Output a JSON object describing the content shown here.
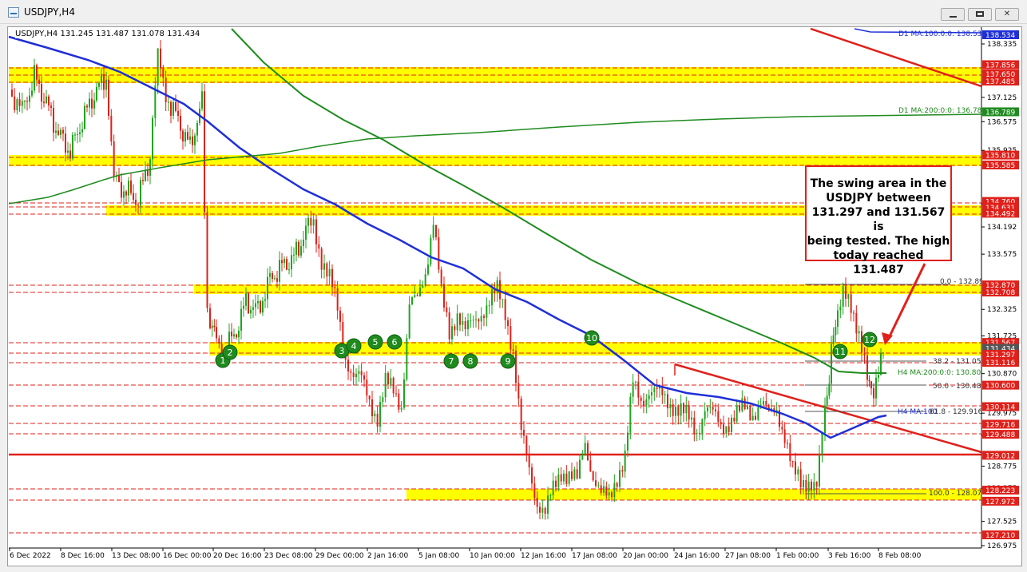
{
  "window": {
    "title": "USDJPY,H4"
  },
  "chart": {
    "header": "USDJPY,H4  131.245 131.487 131.078 131.434",
    "price_labels": [
      "138.335",
      "137.125",
      "136.575",
      "135.925",
      "134.715",
      "134.192",
      "133.575",
      "132.325",
      "131.725",
      "130.870",
      "129.975",
      "129.475",
      "128.775",
      "128.275",
      "127.525",
      "126.975"
    ],
    "x_labels": [
      "6 Dec 2022",
      "8 Dec 16:00",
      "13 Dec 08:00",
      "16 Dec 00:00",
      "20 Dec 16:00",
      "23 Dec 08:00",
      "29 Dec 00:00",
      "2 Jan 16:00",
      "5 Jan 08:00",
      "10 Jan 00:00",
      "12 Jan 16:00",
      "17 Jan 08:00",
      "20 Jan 00:00",
      "24 Jan 16:00",
      "27 Jan 08:00",
      "1 Feb 00:00",
      "3 Feb 16:00",
      "8 Feb 08:00"
    ],
    "level_labels": [
      {
        "text": "138.534",
        "color": "#1f2fd8"
      },
      {
        "text": "137.856",
        "color": "#e0201a"
      },
      {
        "text": "137.650",
        "color": "#e0201a"
      },
      {
        "text": "137.485",
        "color": "#e0201a"
      },
      {
        "text": "136.789",
        "color": "#1f8b1f"
      },
      {
        "text": "135.810",
        "color": "#e0201a"
      },
      {
        "text": "135.585",
        "color": "#e0201a"
      },
      {
        "text": "134.760",
        "color": "#e0201a"
      },
      {
        "text": "134.631",
        "color": "#e0201a"
      },
      {
        "text": "134.492",
        "color": "#e0201a"
      },
      {
        "text": "132.870",
        "color": "#e0201a"
      },
      {
        "text": "132.708",
        "color": "#e0201a"
      },
      {
        "text": "131.567",
        "color": "#e0201a"
      },
      {
        "text": "131.434",
        "color": "#555555"
      },
      {
        "text": "131.297",
        "color": "#e0201a"
      },
      {
        "text": "131.116",
        "color": "#e0201a"
      },
      {
        "text": "130.600",
        "color": "#e0201a"
      },
      {
        "text": "130.114",
        "color": "#e0201a"
      },
      {
        "text": "129.716",
        "color": "#e0201a"
      },
      {
        "text": "129.488",
        "color": "#e0201a"
      },
      {
        "text": "129.012",
        "color": "#e0201a"
      },
      {
        "text": "128.223",
        "color": "#e0201a"
      },
      {
        "text": "127.972",
        "color": "#e0201a"
      },
      {
        "text": "127.210",
        "color": "#e0201a"
      }
    ],
    "ma_labels": {
      "d1_100": "D1 MA:100:0:0: 138.534",
      "d1_200": "D1 MA:200:0:0: 136.789",
      "h4_200": "H4 MA:200:0:0: 130.808",
      "h4_100": "H4 MA:100"
    },
    "fib_labels": {
      "f0": "0.0 - 132.894",
      "f382": "38.2 - 131.054",
      "f50": "50.0 - 130.485",
      "f618": "61.8 - 129.916",
      "f100": "100.0 - 128.076"
    },
    "markers": [
      "1",
      "2",
      "3",
      "4",
      "5",
      "6",
      "7",
      "8",
      "9",
      "10",
      "11",
      "12"
    ]
  },
  "callout": {
    "lines": [
      "The swing area in the",
      "USDJPY between",
      "131.297 and 131.567 is",
      "being tested. The high",
      "today reached 131.487"
    ]
  },
  "colors": {
    "bull": "#1fa51f",
    "bear": "#e0201a",
    "zone": "#ffff00",
    "ma_blue": "#1f2fd8",
    "ma_green": "#1f8b1f"
  }
}
